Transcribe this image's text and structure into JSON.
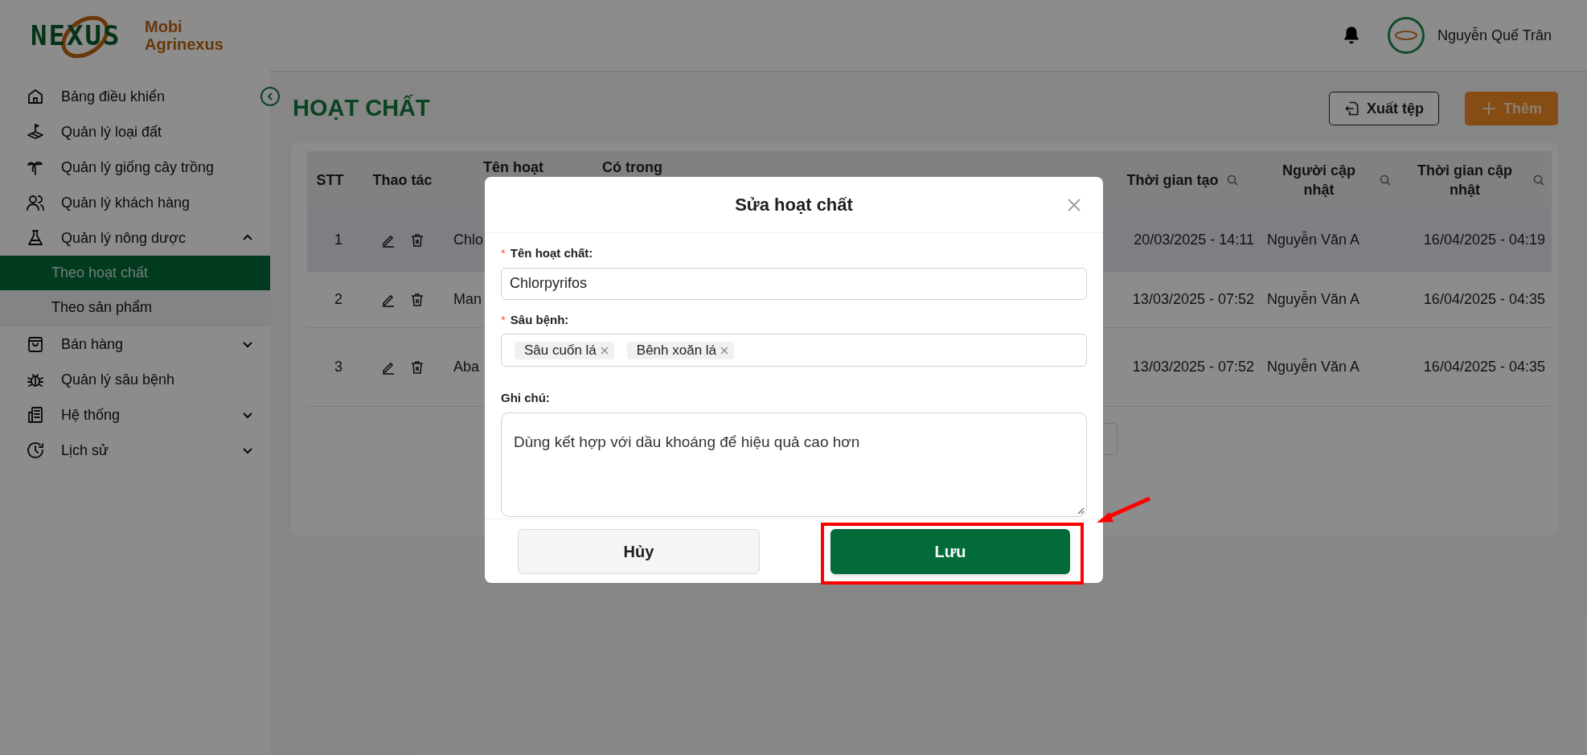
{
  "header": {
    "logo_wordmark": "NEXUS",
    "brand_lines": [
      "Mobi",
      "Agrinexus"
    ],
    "user_name": "Nguyễn Quế Trân"
  },
  "sidebar": {
    "items": [
      {
        "label": "Bảng điều khiển"
      },
      {
        "label": "Quản lý loại đất"
      },
      {
        "label": "Quản lý giống cây trồng"
      },
      {
        "label": "Quản lý khách hàng"
      },
      {
        "label": "Quản lý nông dược",
        "expanded": true,
        "children": [
          {
            "label": "Theo hoạt chất",
            "selected": true
          },
          {
            "label": "Theo sản phẩm",
            "selected": false
          }
        ]
      },
      {
        "label": "Bán hàng",
        "expanded": false
      },
      {
        "label": "Quản lý sâu bệnh"
      },
      {
        "label": "Hệ thống",
        "expanded": false
      },
      {
        "label": "Lịch sử",
        "expanded": false
      }
    ]
  },
  "page": {
    "title": "HOẠT CHẤT",
    "actions": [
      {
        "label": "Xuất tệp",
        "kind": "export"
      },
      {
        "label": "Thêm",
        "kind": "add"
      }
    ]
  },
  "table": {
    "columns": [
      {
        "label": "STT",
        "searchable": false
      },
      {
        "label": "Thao tác",
        "searchable": false
      },
      {
        "label": "Tên hoạt",
        "searchable": false
      },
      {
        "label": "Có trong",
        "searchable": false
      },
      {
        "label": "Thời gian tạo",
        "searchable": true
      },
      {
        "label": "Người cập nhật",
        "searchable": true
      },
      {
        "label": "Thời gian cập nhật",
        "searchable": true
      }
    ],
    "rows": [
      {
        "stt": "1",
        "name": "Chlo",
        "created": "20/03/2025 - 14:11",
        "updated_by": "Nguyễn Văn A",
        "updated": "16/04/2025 - 04:19",
        "selected": true
      },
      {
        "stt": "2",
        "name": "Man",
        "created": "13/03/2025 - 07:52",
        "updated_by": "Nguyễn Văn A",
        "updated": "16/04/2025 - 04:35",
        "selected": false
      },
      {
        "stt": "3",
        "name": "Aba",
        "created": "13/03/2025 - 07:52",
        "updated_by": "Nguyễn Văn A",
        "updated": "16/04/2025 - 04:35",
        "selected": false
      }
    ]
  },
  "dialog": {
    "title": "Sửa hoạt chất",
    "fields": [
      {
        "kind": "text",
        "marker": "*",
        "label": "Tên hoạt chất:",
        "value": "Chlorpyrifos"
      },
      {
        "kind": "tags",
        "marker": "*",
        "label": "Sâu bệnh:",
        "tags": [
          "Sâu cuốn lá",
          "Bênh xoăn lá"
        ]
      },
      {
        "kind": "textarea",
        "label": "Ghi chú:",
        "value": "Dùng kết hợp với dầu khoáng để hiệu quả cao hơn"
      }
    ],
    "buttons": [
      {
        "label": "Hủy",
        "kind": "secondary"
      },
      {
        "label": "Lưu",
        "kind": "primary"
      }
    ]
  }
}
